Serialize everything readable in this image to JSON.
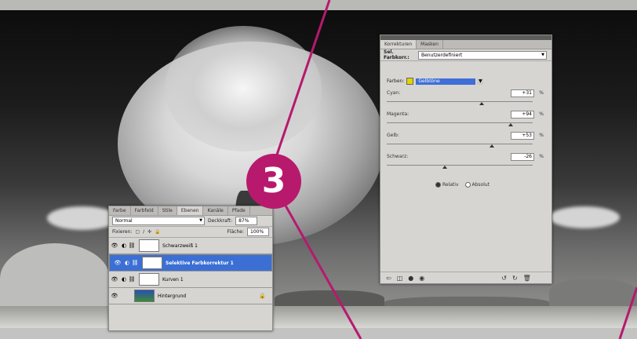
{
  "step_number": "3",
  "colors": {
    "accent": "#b7196d",
    "selection": "#3b6fd4"
  },
  "adjustments_panel": {
    "tabs": [
      "Korrekturen",
      "Masken"
    ],
    "preset_label": "Sel. Farbkorr.:",
    "preset_value": "Benutzerdefiniert",
    "farben_label": "Farben:",
    "farben_value": "Gelbtöne",
    "sliders": [
      {
        "label": "Cyan:",
        "value": "+31",
        "unit": "%",
        "level": 0.65
      },
      {
        "label": "Magenta:",
        "value": "+94",
        "unit": "%",
        "level": 0.85
      },
      {
        "label": "Gelb:",
        "value": "+53",
        "unit": "%",
        "level": 0.72
      },
      {
        "label": "Schwarz:",
        "value": "-26",
        "unit": "%",
        "level": 0.4
      }
    ],
    "method_relative": "Relativ",
    "method_absolute": "Absolut",
    "footer_icons": [
      "back-arrow-icon",
      "layer-view-icon",
      "visibility-icon",
      "eye-icon",
      "reset-icon",
      "trash-icon"
    ]
  },
  "layers_panel": {
    "tabs": [
      "Farbe",
      "Farbfeld",
      "Stile",
      "Ebenen",
      "Kanäle",
      "Pfade"
    ],
    "blend_mode": "Normal",
    "opacity_label": "Deckkraft:",
    "opacity_value": "87%",
    "lock_label": "Fixieren:",
    "fill_label": "Fläche:",
    "fill_value": "100%",
    "layers": [
      {
        "name": "Schwarzweiß 1",
        "selected": false
      },
      {
        "name": "Selektive Farbkorrektur 1",
        "selected": true
      },
      {
        "name": "Kurven 1",
        "selected": false
      },
      {
        "name": "Hintergrund",
        "selected": false,
        "locked": true
      }
    ]
  }
}
